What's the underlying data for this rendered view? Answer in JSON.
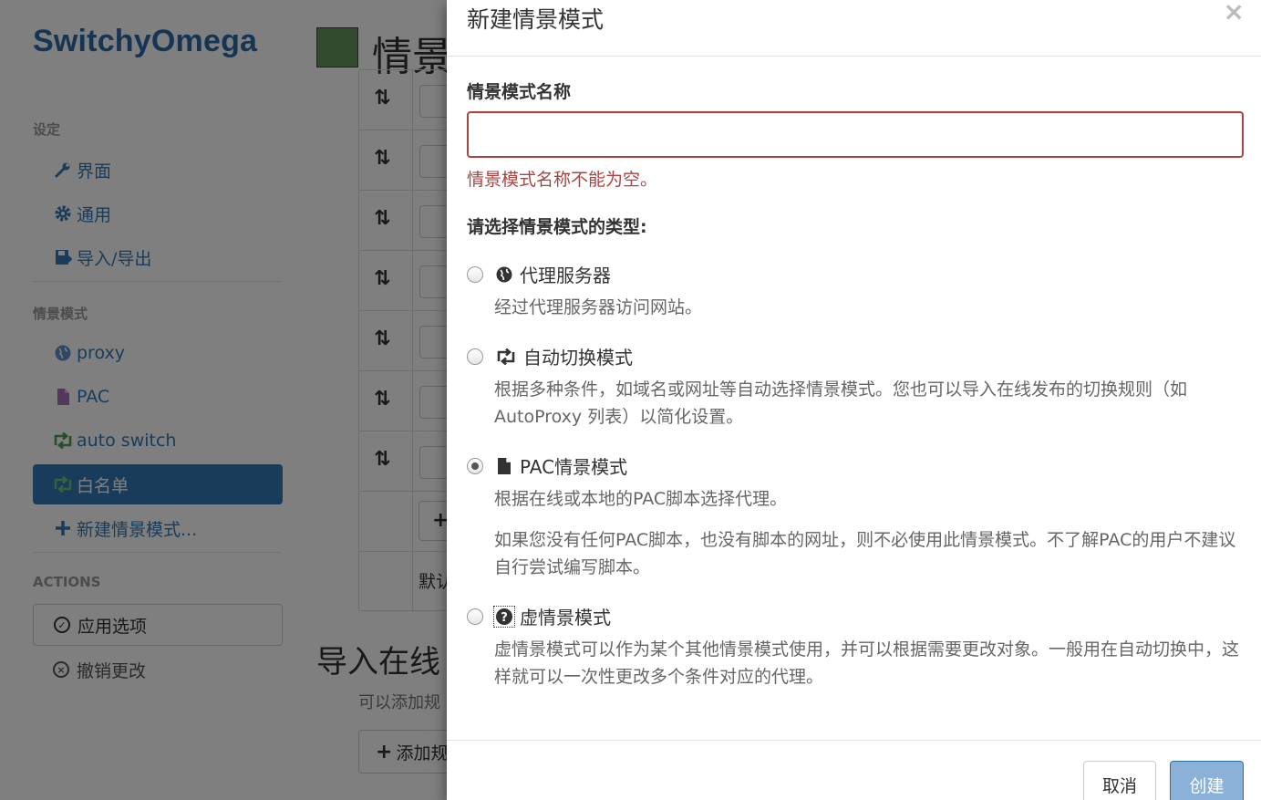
{
  "app": {
    "brand": "SwitchyOmega",
    "nav": {
      "settings_header": "设定",
      "settings_items": [
        {
          "label": "界面",
          "icon": "wrench-icon"
        },
        {
          "label": "通用",
          "icon": "gear-icon"
        },
        {
          "label": "导入/导出",
          "icon": "floppy-icon"
        }
      ],
      "profiles_header": "情景模式",
      "profile_items": [
        {
          "label": "proxy",
          "icon": "globe-icon"
        },
        {
          "label": "PAC",
          "icon": "file-icon"
        },
        {
          "label": "auto switch",
          "icon": "retweet-icon"
        },
        {
          "label": "白名单",
          "icon": "retweet-icon",
          "active": true
        }
      ],
      "new_profile": "新建情景模式...",
      "actions_header": "ACTIONS",
      "apply_label": "应用选项",
      "discard_label": "撤销更改"
    },
    "page": {
      "title": "情景",
      "color": "#65975e",
      "default_row_text": "默认",
      "import_title": "导入在线",
      "import_help": "可以添加规",
      "add_rule_label": "添加规"
    }
  },
  "modal": {
    "title": "新建情景模式",
    "close": "×",
    "name_label": "情景模式名称",
    "name_value": "",
    "name_error": "情景模式名称不能为空。",
    "type_label": "请选择情景模式的类型:",
    "options": [
      {
        "title": "代理服务器",
        "icon": "globe-icon",
        "checked": false,
        "desc": [
          "经过代理服务器访问网站。"
        ]
      },
      {
        "title": "自动切换模式",
        "icon": "retweet-icon",
        "checked": false,
        "desc": [
          "根据多种条件，如域名或网址等自动选择情景模式。您也可以导入在线发布的切换规则（如 AutoProxy 列表）以简化设置。"
        ]
      },
      {
        "title": "PAC情景模式",
        "icon": "file-icon",
        "checked": true,
        "desc": [
          "根据在线或本地的PAC脚本选择代理。",
          "如果您没有任何PAC脚本，也没有脚本的网址，则不必使用此情景模式。不了解PAC的用户不建议自行尝试编写脚本。"
        ]
      },
      {
        "title": "虚情景模式",
        "icon": "question-icon",
        "checked": false,
        "desc": [
          "虚情景模式可以作为某个其他情景模式使用，并可以根据需要更改对象。一般用在自动切换中，这样就可以一次性更改多个条件对应的代理。"
        ]
      }
    ],
    "cancel_label": "取消",
    "create_label": "创建"
  },
  "colors": {
    "brand": "#2c6aa8",
    "link": "#3279b7",
    "error": "#a94442",
    "primary_disabled": "#8bb1d8"
  }
}
